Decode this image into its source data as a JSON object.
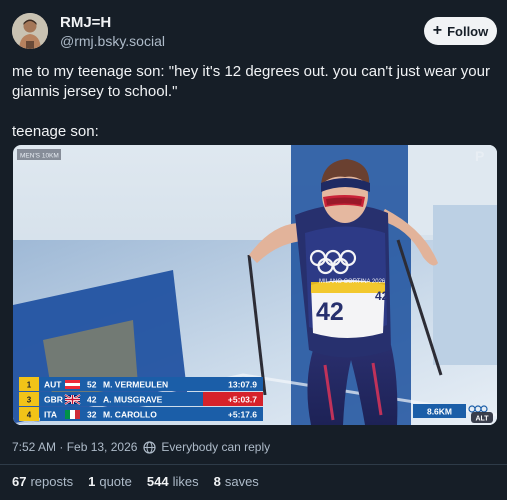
{
  "author": {
    "display_name": "RMJ=H",
    "handle": "@rmj.bsky.social"
  },
  "follow_button": {
    "label": "Follow"
  },
  "post": {
    "paragraphs": [
      "me to my teenage son: \"hey it's 12 degrees out. you can't just wear your giannis jersey to school.\"",
      "teenage son:"
    ]
  },
  "image": {
    "event_label": "MEN'S 10KM",
    "bib_number": "42",
    "bib_number_small": "42",
    "bib_sponsor": "MILANO CORTINA 2026",
    "distance_label": "8.6KM",
    "alt_badge": "ALT",
    "scoreboard": [
      {
        "pos": "1",
        "nation": "AUT",
        "bib": "52",
        "name": "M. VERMEULEN",
        "time": "13:07.9",
        "highlight": false
      },
      {
        "pos": "3",
        "nation": "GBR",
        "bib": "42",
        "name": "A. MUSGRAVE",
        "time": "+5:03.7",
        "highlight": true
      },
      {
        "pos": "4",
        "nation": "ITA",
        "bib": "32",
        "name": "M. CAROLLO",
        "time": "+5:17.6",
        "highlight": false
      }
    ],
    "colors": {
      "board_blue": "#1b5ea8",
      "board_red": "#d6222a",
      "pos_yellow": "#f2c318"
    }
  },
  "meta": {
    "timestamp": "7:52 AM · Feb 13, 2026",
    "reply_setting": "Everybody can reply"
  },
  "stats": [
    {
      "num": "67",
      "label": "reposts"
    },
    {
      "num": "1",
      "label": "quote"
    },
    {
      "num": "544",
      "label": "likes"
    },
    {
      "num": "8",
      "label": "saves"
    }
  ]
}
